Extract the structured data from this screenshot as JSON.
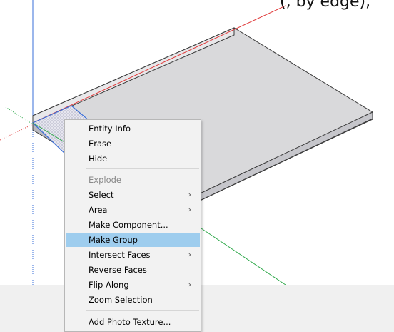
{
  "viewport": {
    "top_cutoff_text": "(, by edge),",
    "axis_colors": {
      "red": "#e03a3a",
      "green": "#2ea84a",
      "blue": "#3a6fd8"
    },
    "slab_colors": {
      "top": "#d9d9db",
      "front": "#c6c6cb",
      "side": "#b9b9bf",
      "edge": "#3c3c3c"
    }
  },
  "context_menu": {
    "items": [
      {
        "label": "Entity Info",
        "disabled": false,
        "submenu": false,
        "highlighted": false
      },
      {
        "label": "Erase",
        "disabled": false,
        "submenu": false,
        "highlighted": false
      },
      {
        "label": "Hide",
        "disabled": false,
        "submenu": false,
        "highlighted": false
      },
      {
        "label": "Explode",
        "disabled": true,
        "submenu": false,
        "highlighted": false
      },
      {
        "label": "Select",
        "disabled": false,
        "submenu": true,
        "highlighted": false
      },
      {
        "label": "Area",
        "disabled": false,
        "submenu": true,
        "highlighted": false
      },
      {
        "label": "Make Component...",
        "disabled": false,
        "submenu": false,
        "highlighted": false
      },
      {
        "label": "Make Group",
        "disabled": false,
        "submenu": false,
        "highlighted": true
      },
      {
        "label": "Intersect Faces",
        "disabled": false,
        "submenu": true,
        "highlighted": false
      },
      {
        "label": "Reverse Faces",
        "disabled": false,
        "submenu": false,
        "highlighted": false
      },
      {
        "label": "Flip Along",
        "disabled": false,
        "submenu": true,
        "highlighted": false
      },
      {
        "label": "Zoom Selection",
        "disabled": false,
        "submenu": false,
        "highlighted": false
      },
      {
        "label": "Add Photo Texture...",
        "disabled": false,
        "submenu": false,
        "highlighted": false
      }
    ],
    "submenu_arrow_glyph": "›",
    "highlight_color": "#9ecdee"
  }
}
